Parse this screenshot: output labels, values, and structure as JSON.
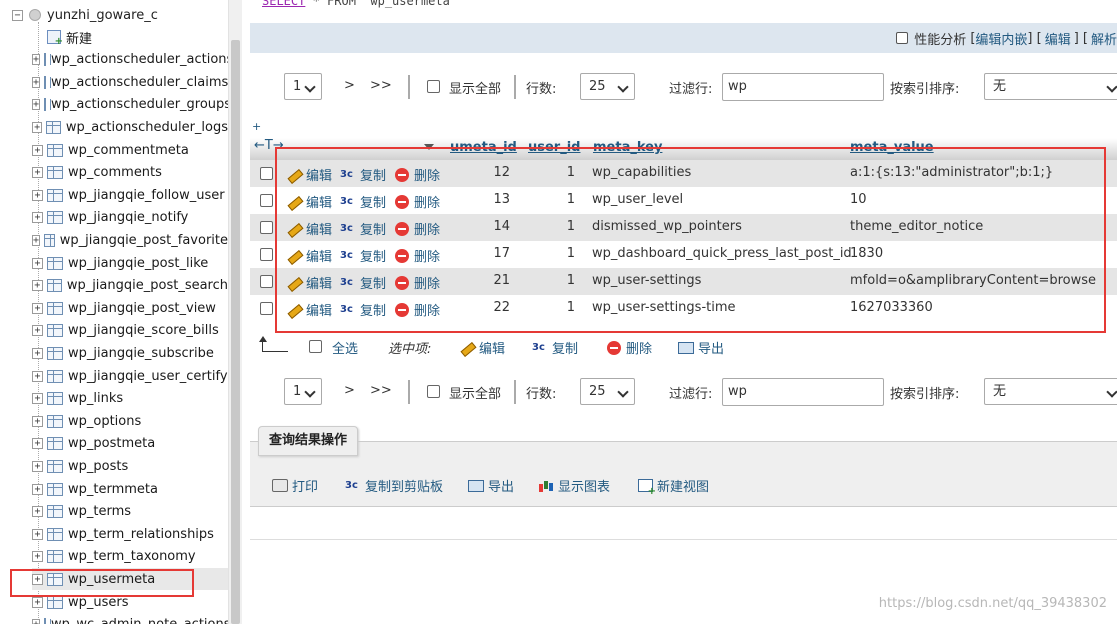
{
  "sidebar": {
    "database": {
      "expander": "−",
      "name": "yunzhi_goware_c"
    },
    "new_label": "新建",
    "tables": [
      "wp_actionscheduler_actions",
      "wp_actionscheduler_claims",
      "wp_actionscheduler_groups",
      "wp_actionscheduler_logs",
      "wp_commentmeta",
      "wp_comments",
      "wp_jiangqie_follow_user",
      "wp_jiangqie_notify",
      "wp_jiangqie_post_favorite",
      "wp_jiangqie_post_like",
      "wp_jiangqie_post_search",
      "wp_jiangqie_post_view",
      "wp_jiangqie_score_bills",
      "wp_jiangqie_subscribe",
      "wp_jiangqie_user_certify",
      "wp_links",
      "wp_options",
      "wp_postmeta",
      "wp_posts",
      "wp_termmeta",
      "wp_terms",
      "wp_term_relationships",
      "wp_term_taxonomy",
      "wp_usermeta",
      "wp_users",
      "wp_wc_admin_note_actions"
    ],
    "selected": "wp_usermeta"
  },
  "query": {
    "keyword1": "SELECT",
    "rest": " * FROM `wp_usermeta`"
  },
  "profile_bar": {
    "profiling": "性能分析",
    "lb1": "[",
    "edit_inline": "编辑内嵌",
    "sep": "] [",
    "edit": "编辑",
    "sep2": "] [",
    "explain": "解析"
  },
  "nav": {
    "page": "1",
    "next": ">",
    "last": ">>",
    "show_all": "显示全部",
    "rows_label": "行数:",
    "rows_value": "25",
    "filter_label": "过滤行:",
    "filter_value": "wp",
    "sort_label": "按索引排序:",
    "sort_value": "无"
  },
  "table": {
    "plus": "+",
    "arrows": "←T→",
    "columns": [
      "umeta_id",
      "user_id",
      "meta_key",
      "meta_value"
    ],
    "actions": {
      "edit": "编辑",
      "copy": "复制",
      "delete": "删除"
    },
    "rows": [
      {
        "umeta_id": "12",
        "user_id": "1",
        "meta_key": "wp_capabilities",
        "meta_value": "a:1:{s:13:\"administrator\";b:1;}"
      },
      {
        "umeta_id": "13",
        "user_id": "1",
        "meta_key": "wp_user_level",
        "meta_value": "10"
      },
      {
        "umeta_id": "14",
        "user_id": "1",
        "meta_key": "dismissed_wp_pointers",
        "meta_value": "theme_editor_notice"
      },
      {
        "umeta_id": "17",
        "user_id": "1",
        "meta_key": "wp_dashboard_quick_press_last_post_id",
        "meta_value": "1830"
      },
      {
        "umeta_id": "21",
        "user_id": "1",
        "meta_key": "wp_user-settings",
        "meta_value": "mfold=o&amplibraryContent=browse"
      },
      {
        "umeta_id": "22",
        "user_id": "1",
        "meta_key": "wp_user-settings-time",
        "meta_value": "1627033360"
      }
    ]
  },
  "selection": {
    "select_all": "全选",
    "with_selected": "选中项:",
    "edit": "编辑",
    "copy": "复制",
    "delete": "删除",
    "export": "导出"
  },
  "query_ops": {
    "legend": "查询结果操作",
    "print": "打印",
    "copy_clipboard": "复制到剪贴板",
    "export": "导出",
    "display_chart": "显示图表",
    "create_view": "新建视图"
  },
  "watermark": "https://blog.csdn.net/qq_39438302",
  "colors": {
    "link": "#235a81",
    "highlight_box": "#e53935",
    "row_alt": "#e5e5e5"
  }
}
